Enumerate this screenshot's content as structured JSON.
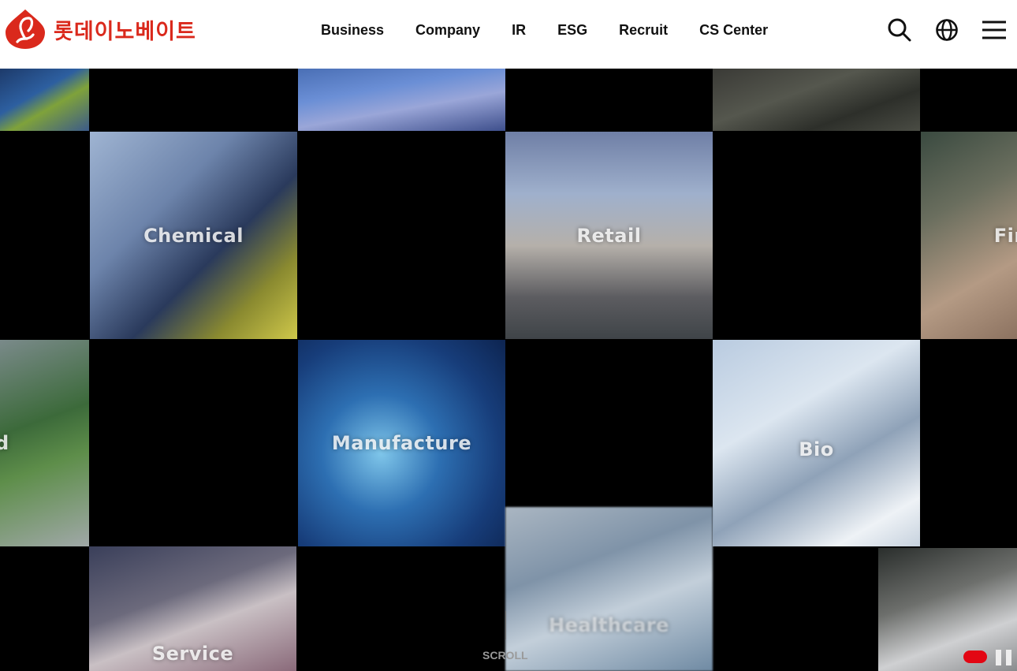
{
  "brand": {
    "name": "롯데이노베이트",
    "color": "#da291c"
  },
  "nav": {
    "items": [
      {
        "label": "Business"
      },
      {
        "label": "Company"
      },
      {
        "label": "IR"
      },
      {
        "label": "ESG"
      },
      {
        "label": "Recruit"
      },
      {
        "label": "CS Center"
      }
    ]
  },
  "header_icons": [
    "search-icon",
    "globe-icon",
    "menu-icon"
  ],
  "tiles": {
    "chemical": "Chemical",
    "retail": "Retail",
    "finance_partial": "Fin",
    "manufacture": "Manufacture",
    "bio": "Bio",
    "healthcare": "Healthcare",
    "service": "Service",
    "left_partial": "d"
  },
  "scroll_label": "SCROLL",
  "controls": {
    "toggle_color": "#e30613"
  }
}
